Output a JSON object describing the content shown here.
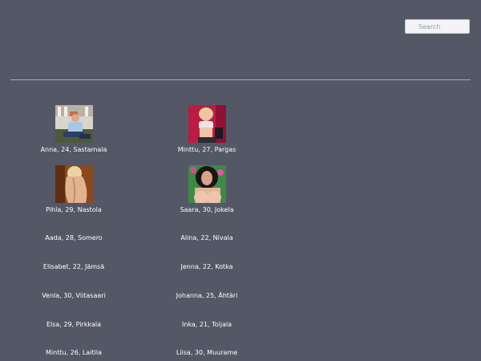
{
  "search": {
    "placeholder": "Search"
  },
  "profiles": [
    {
      "label": "Anna, 24, Sastamala"
    },
    {
      "label": "Minttu, 27, Pargas"
    },
    {
      "label": "Pihla, 29, Nastola"
    },
    {
      "label": "Saara, 30, Jokela"
    },
    {
      "label": "Aada, 28, Somero"
    },
    {
      "label": "Alina, 22, Nivala"
    },
    {
      "label": "Elisabet, 22, Jämsä"
    },
    {
      "label": "Jenna, 22, Kotka"
    },
    {
      "label": "Venla, 30, Viitasaari"
    },
    {
      "label": "Johanna, 25, Ähtäri"
    },
    {
      "label": "Elsa, 29, Pirkkala"
    },
    {
      "label": "Inka, 21, Toijala"
    },
    {
      "label": "Minttu, 26, Laitila"
    },
    {
      "label": "Liisa, 30, Muurame"
    }
  ]
}
